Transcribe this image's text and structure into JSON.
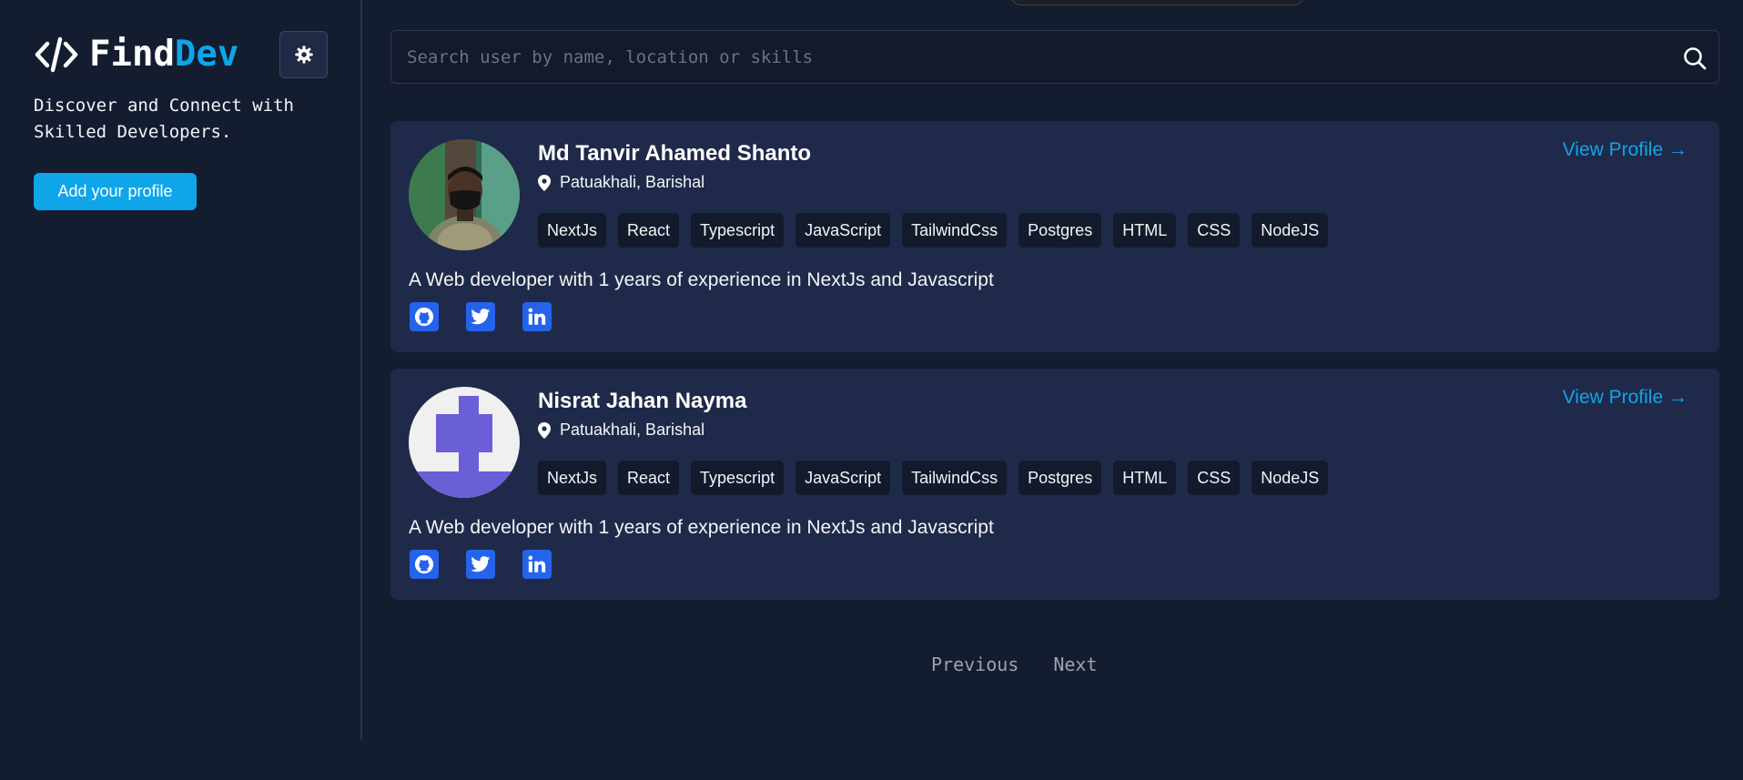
{
  "brand": {
    "logo_prefix": "Find",
    "logo_accent": "Dev",
    "tagline": "Discover and Connect with Skilled Developers.",
    "accent_color": "#0ea5e9"
  },
  "sidebar": {
    "add_profile_label": "Add your profile",
    "theme_icon": "gear-icon"
  },
  "search": {
    "placeholder": "Search user by name, location or skills",
    "value": ""
  },
  "profiles": [
    {
      "name": "Md Tanvir Ahamed Shanto",
      "location": "Patuakhali, Barishal",
      "skills": [
        "NextJs",
        "React",
        "Typescript",
        "JavaScript",
        "TailwindCss",
        "Postgres",
        "HTML",
        "CSS",
        "NodeJS"
      ],
      "bio": "A Web developer with 1 years of experience in NextJs and Javascript",
      "view_label": "View Profile →",
      "avatar": "photo-avatar"
    },
    {
      "name": "Nisrat Jahan Nayma",
      "location": "Patuakhali, Barishal",
      "skills": [
        "NextJs",
        "React",
        "Typescript",
        "JavaScript",
        "TailwindCss",
        "Postgres",
        "HTML",
        "CSS",
        "NodeJS"
      ],
      "bio": "A Web developer with 1 years of experience in NextJs and Javascript",
      "view_label": "View Profile →",
      "avatar": "identicon-avatar"
    }
  ],
  "pagination": {
    "previous_label": "Previous",
    "next_label": "Next"
  }
}
